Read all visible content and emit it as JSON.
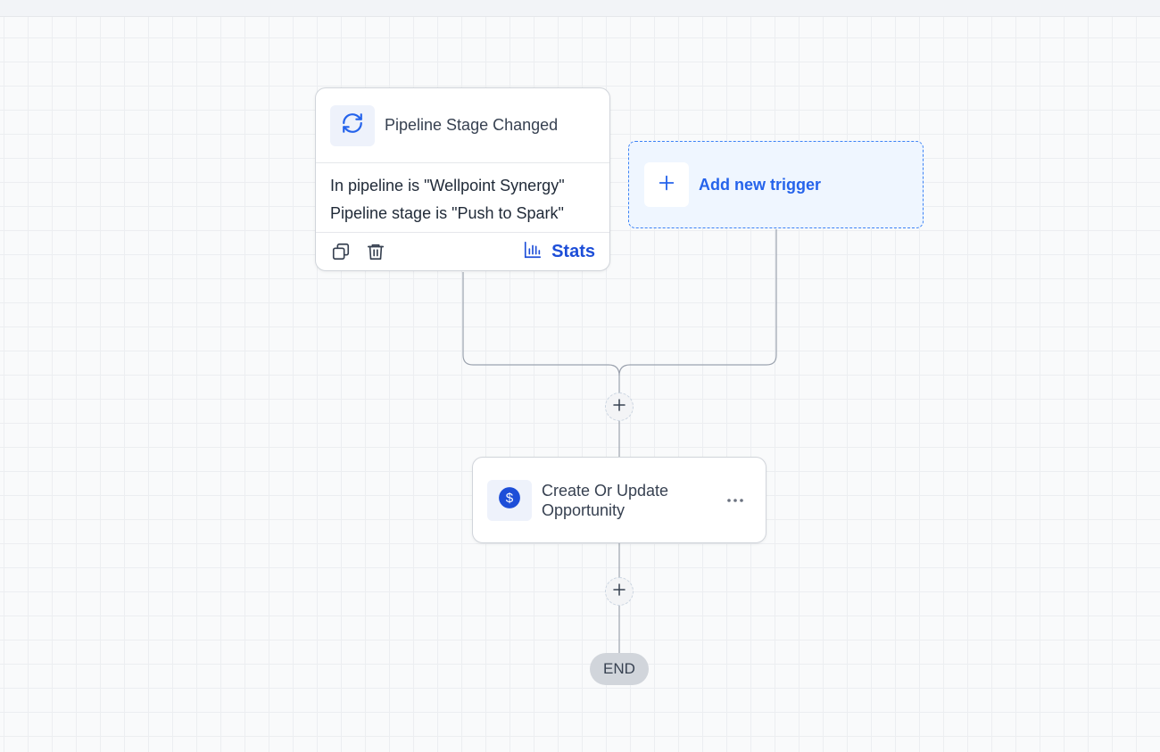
{
  "trigger": {
    "title": "Pipeline Stage Changed",
    "icon": "refresh-icon",
    "conditions": [
      "In pipeline is \"Wellpoint Synergy\"",
      "Pipeline stage is \"Push to Spark\""
    ],
    "actions": {
      "copy_icon": "copy-icon",
      "delete_icon": "trash-icon",
      "stats_icon": "bar-chart-icon",
      "stats_label": "Stats"
    }
  },
  "add_trigger": {
    "label": "Add new trigger",
    "icon": "plus-icon"
  },
  "add_step_icon": "plus-icon",
  "action": {
    "title": "Create Or Update Opportunity",
    "icon": "dollar-icon",
    "menu_icon": "more-horizontal-icon"
  },
  "end": {
    "label": "END"
  },
  "colors": {
    "accent": "#2563eb",
    "accent_dark": "#1d4ed8",
    "trigger_bg": "#eff6ff",
    "icon_tile_bg": "#eef2fb",
    "end_bg": "#d1d5db",
    "connector": "#9ca3af"
  }
}
